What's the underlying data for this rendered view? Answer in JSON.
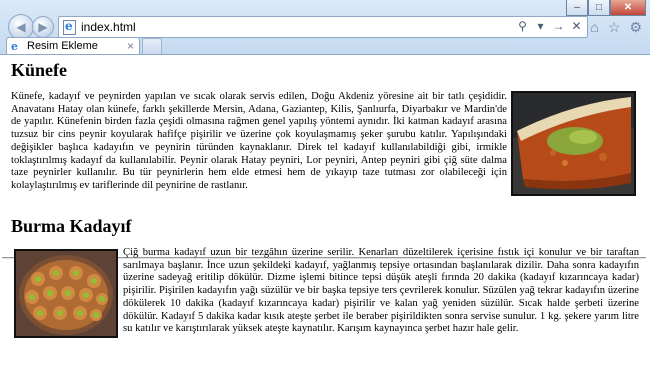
{
  "browser": {
    "address": "index.html",
    "tab_label": "Resim Ekleme",
    "tab_close": "×"
  },
  "sections": [
    {
      "title": "Künefe",
      "text": "Künefe, kadayıf ve peynirden yapılan ve sıcak olarak servis edilen, Doğu Akdeniz yöresine ait bir tatlı çeşididir. Anavatanı Hatay olan künefe, farklı şekillerde Mersin, Adana, Gaziantep, Kilis, Şanlıurfa, Diyarbakır ve Mardin'de de yapılır. Künefenin birden fazla çeşidi olmasına rağmen genel yapılış yöntemi aynıdır. İki katman kadayıf arasına tuzsuz bir cins peynir koyularak hafifçe pişirilir ve üzerine çok koyulaşmamış şeker şurubu katılır. Yapılışındaki değişikler başlıca kadayıfın ve peynirin türünden kaynaklanır. Direk tel kadayıf kullanılabildiği gibi, irmikle toklaştırılmış kadayıf da kullanılabilir. Peynir olarak Hatay peyniri, Lor peyniri, Antep peyniri gibi çiğ süte dalma taze peynirler kullanılır. Bu tür peynirlerin hem elde etmesi hem de yıkayıp taze tutması zor olabileceği için kolaylaştırılmış ev tariflerinde dil peynirine de rastlanır."
    },
    {
      "title": "Burma Kadayıf",
      "text": "Çiğ burma kadayıf uzun bir tezgâhın üzerine serilir. Kenarları düzeltilerek içerisine fıstık içi konulur ve bir taraftan sarılmaya başlanır. İnce uzun şekildeki kadayıf, yağlanmış tepsiye ortasından başlanılarak dizilir. Daha sonra kadayıfın üzerine sadeyağ eritilip dökülür. Dizme işlemi bitince tepsi düşük ateşli fırında 20 dakika (kadayıf kızarıncaya kadar) pişirilir. Pişirilen kadayıfın yağı süzülür ve bir başka tepsiye ters çevrilerek konulur. Süzülen yağ tekrar kadayıfın üzerine dökülerek 10 dakika (kadayıf kızarıncaya kadar) pişirilir ve kalan yağ yeniden süzülür. Sıcak halde şerbeti üzerine dökülür. Kadayıf 5 dakika kadar kısık ateşte şerbet ile beraber pişirildikten sonra servise sunulur. 1 kg. şekere yarım litre su katılır ve karıştırılarak yüksek ateşte kaynatılır. Karışım kaynayınca şerbet hazır hale gelir."
    }
  ]
}
